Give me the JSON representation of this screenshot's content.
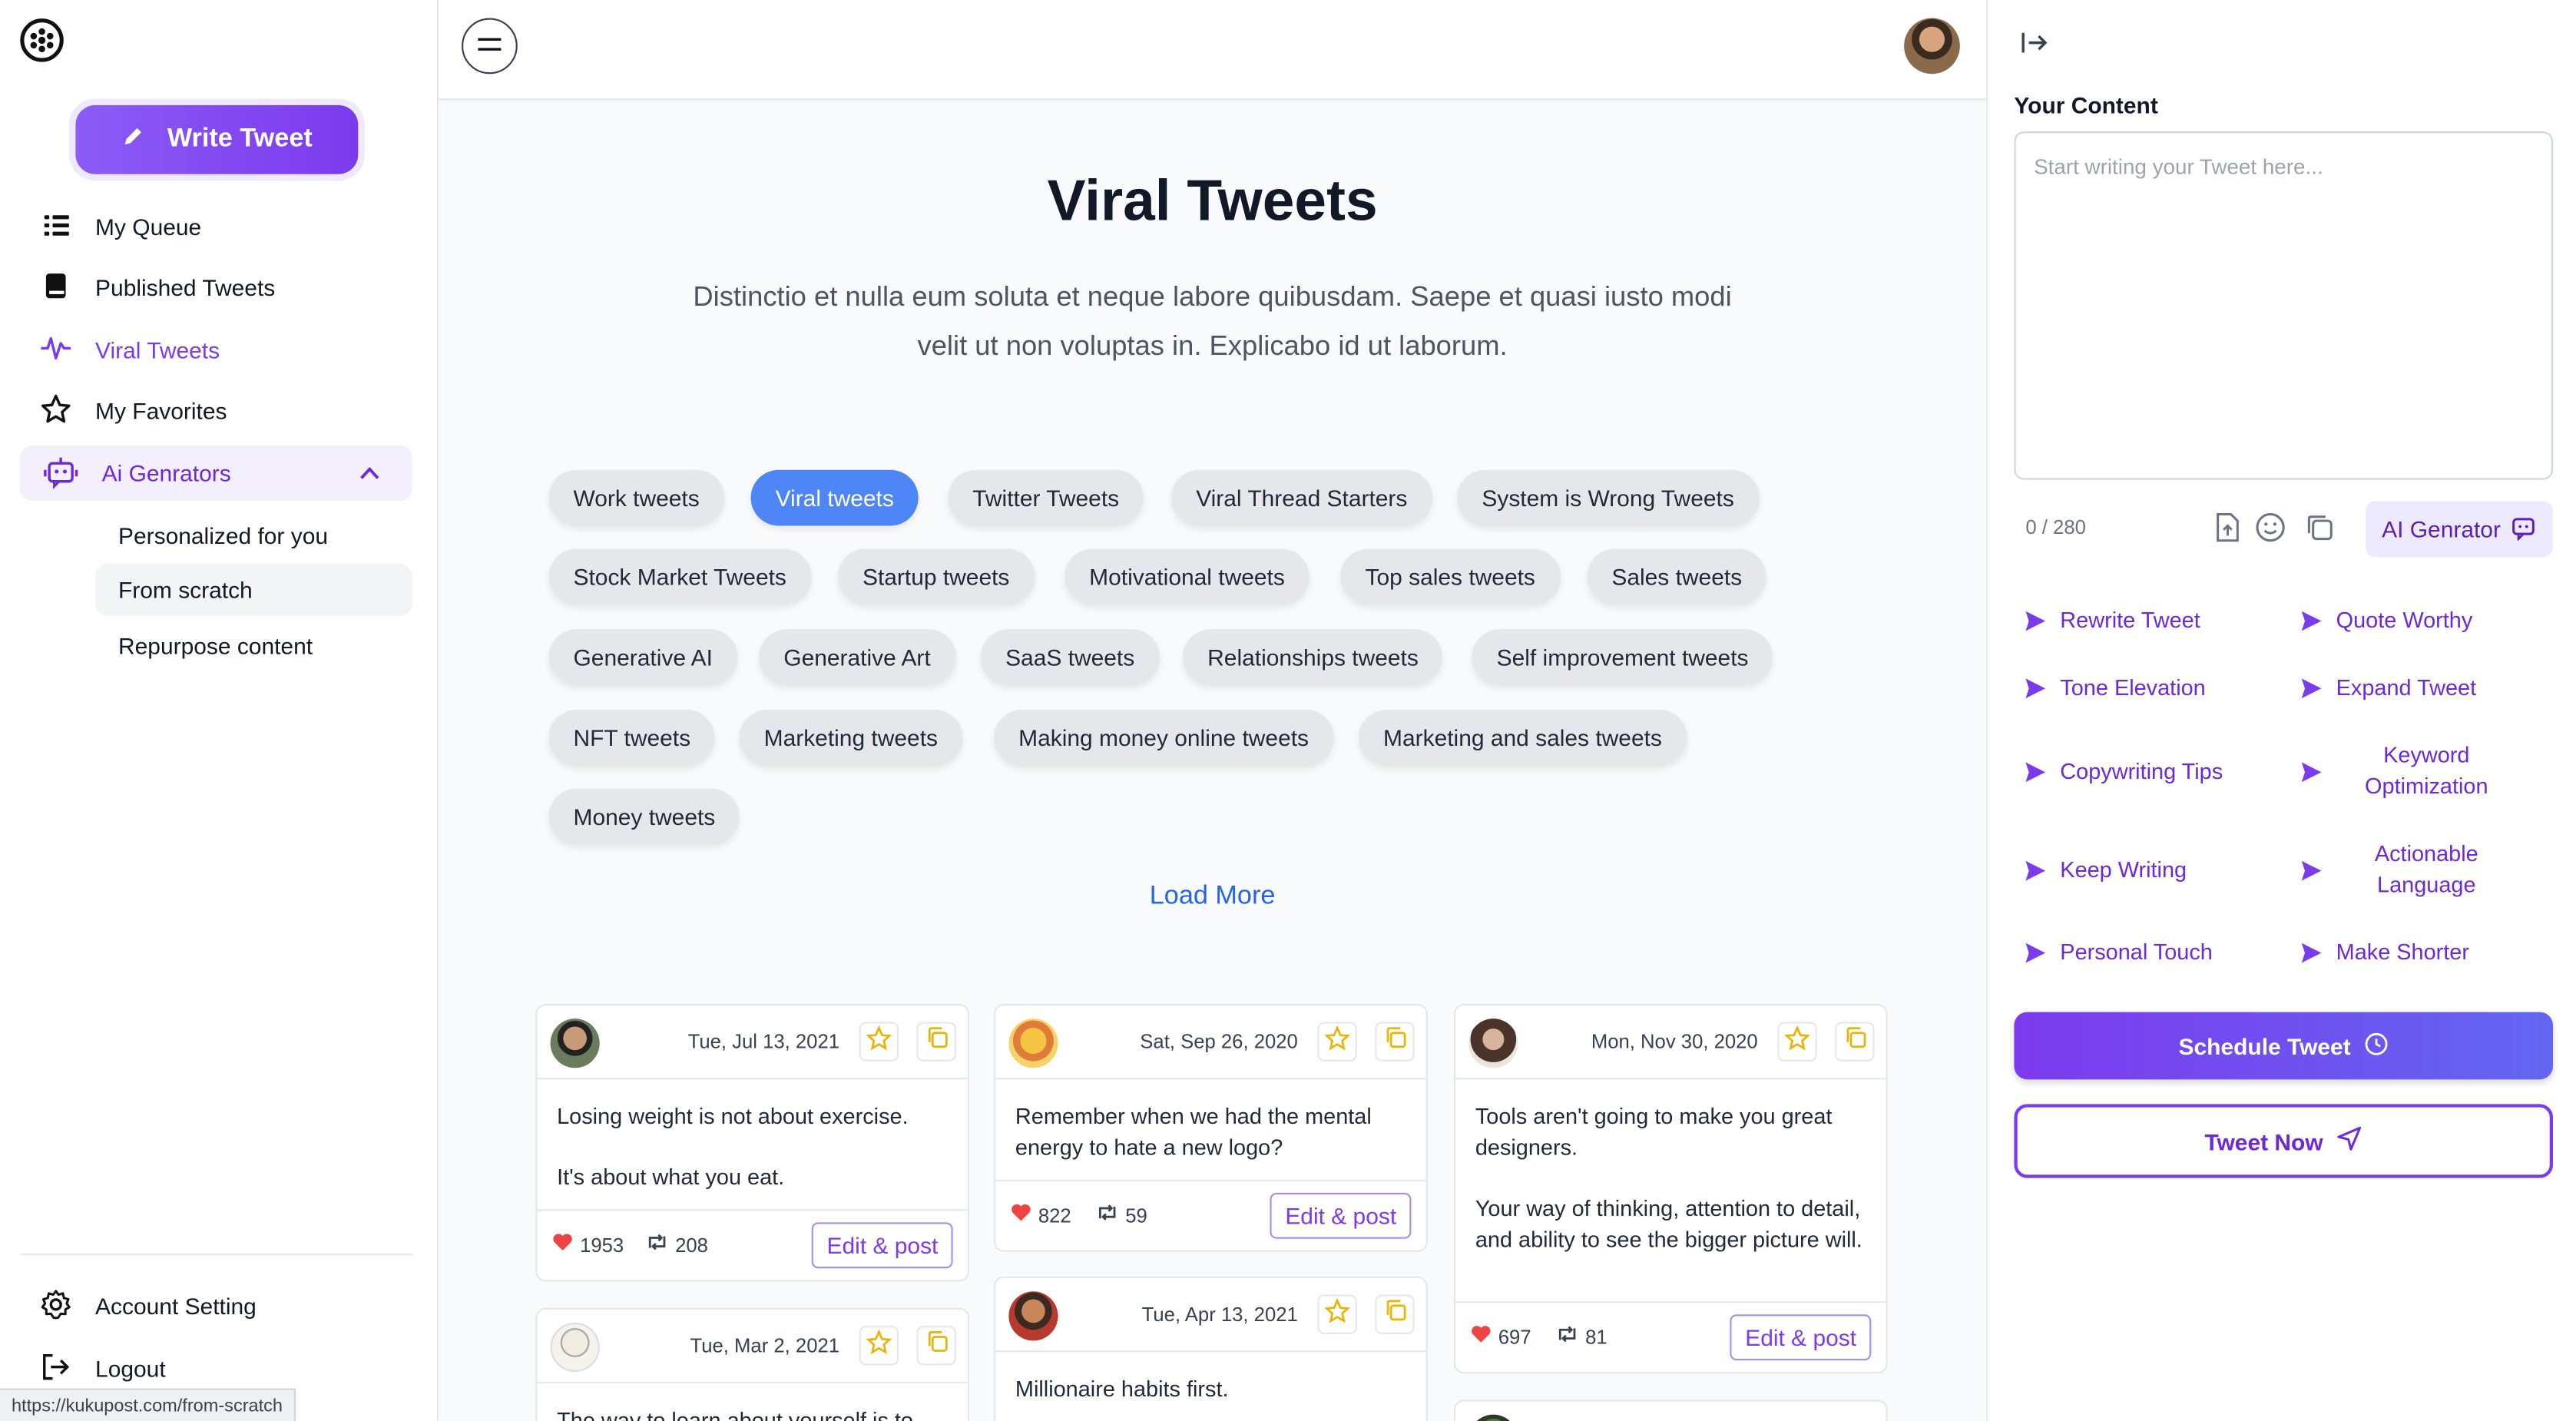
{
  "sidebar": {
    "write_label": "Write Tweet",
    "items": [
      {
        "label": "My Queue"
      },
      {
        "label": "Published Tweets"
      },
      {
        "label": "Viral Tweets"
      },
      {
        "label": "My Favorites"
      }
    ],
    "group": {
      "label": "Ai Genrators",
      "sub": [
        "Personalized for you",
        "From scratch",
        "Repurpose content"
      ]
    },
    "bottom": [
      "Account Setting",
      "Logout"
    ],
    "status_url": "https://kukupost.com/from-scratch"
  },
  "main": {
    "title": "Viral Tweets",
    "description": "Distinctio et nulla eum soluta et neque labore quibusdam. Saepe et quasi iusto modi velit ut non voluptas in. Explicabo id ut laborum.",
    "tags": [
      "Work tweets",
      "Viral tweets",
      "Twitter Tweets",
      "Viral Thread Starters",
      "System is Wrong Tweets",
      "Stock Market Tweets",
      "Startup tweets",
      "Motivational tweets",
      "Top sales tweets",
      "Sales tweets",
      "Generative AI",
      "Generative Art",
      "SaaS tweets",
      "Relationships tweets",
      "Self improvement tweets",
      "NFT tweets",
      "Marketing tweets",
      "Making money online tweets",
      "Marketing and sales tweets",
      "Money tweets"
    ],
    "active_tag": "Viral tweets",
    "load_more": "Load More",
    "edit_label": "Edit & post",
    "cards": [
      {
        "date": "Tue, Jul 13, 2021",
        "lines": [
          "Losing weight is not about exercise.",
          "It's about what you eat."
        ],
        "likes": "1953",
        "retweets": "208"
      },
      {
        "date": "Sat, Sep 26, 2020",
        "lines": [
          "Remember when we had the mental energy to hate a new logo?"
        ],
        "likes": "822",
        "retweets": "59"
      },
      {
        "date": "Mon, Nov 30, 2020",
        "lines": [
          "Tools aren't going to make you great designers.",
          "Your way of thinking, attention to detail, and ability to see the bigger picture will."
        ],
        "likes": "697",
        "retweets": "81"
      },
      {
        "date": "Tue, Mar 2, 2021",
        "lines": [
          "The way to learn about yourself is to"
        ]
      },
      {
        "date": "Tue, Apr 13, 2021",
        "lines": [
          "Millionaire habits first."
        ]
      }
    ]
  },
  "right": {
    "label": "Your Content",
    "placeholder": "Start writing your Tweet here...",
    "char_count": "0 / 280",
    "ai_btn": "AI Genrator",
    "actions": [
      "Rewrite Tweet",
      "Quote Worthy",
      "Tone Elevation",
      "Expand Tweet",
      "Copywriting Tips",
      "Keyword Optimization",
      "Keep Writing",
      "Actionable Language",
      "Personal Touch",
      "Make Shorter"
    ],
    "schedule": "Schedule Tweet",
    "tweet_now": "Tweet Now"
  },
  "colors": {
    "accent": "#7c3aed",
    "active_tag": "#4f86f7",
    "link": "#2563eb"
  }
}
